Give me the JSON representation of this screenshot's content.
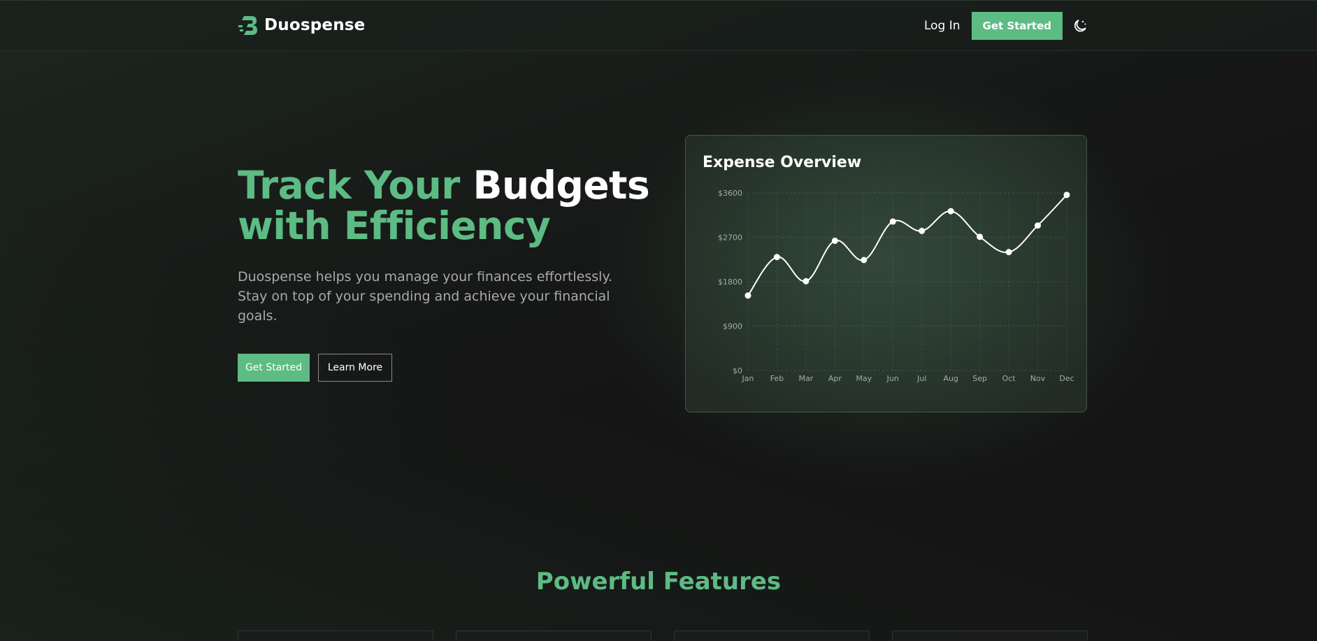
{
  "brand": {
    "name": "Duospense",
    "accent_color": "#5dbb84"
  },
  "nav": {
    "login_label": "Log In",
    "get_started_label": "Get Started",
    "theme_icon": "moon-sun-icon"
  },
  "hero": {
    "title_part1": "Track Your",
    "title_part2": "Budgets",
    "title_part3": "with Efficiency",
    "subtitle": "Duospense helps you manage your finances effortlessly. Stay on top of your spending and achieve your financial goals.",
    "primary_button": "Get Started",
    "secondary_button": "Learn More"
  },
  "chart": {
    "title": "Expense Overview"
  },
  "chart_data": {
    "type": "line",
    "title": "Expense Overview",
    "categories": [
      "Jan",
      "Feb",
      "Mar",
      "Apr",
      "May",
      "Jun",
      "Jul",
      "Aug",
      "Sep",
      "Oct",
      "Nov",
      "Dec"
    ],
    "values": [
      1520,
      2300,
      1810,
      2630,
      2240,
      3020,
      2830,
      3230,
      2710,
      2400,
      2940,
      3560
    ],
    "y_ticks": [
      "$0",
      "$900",
      "$1800",
      "$2700",
      "$3600"
    ],
    "ylim": [
      0,
      3600
    ],
    "grid": true,
    "line_color": "#ffffff"
  },
  "features": {
    "title": "Powerful Features"
  }
}
